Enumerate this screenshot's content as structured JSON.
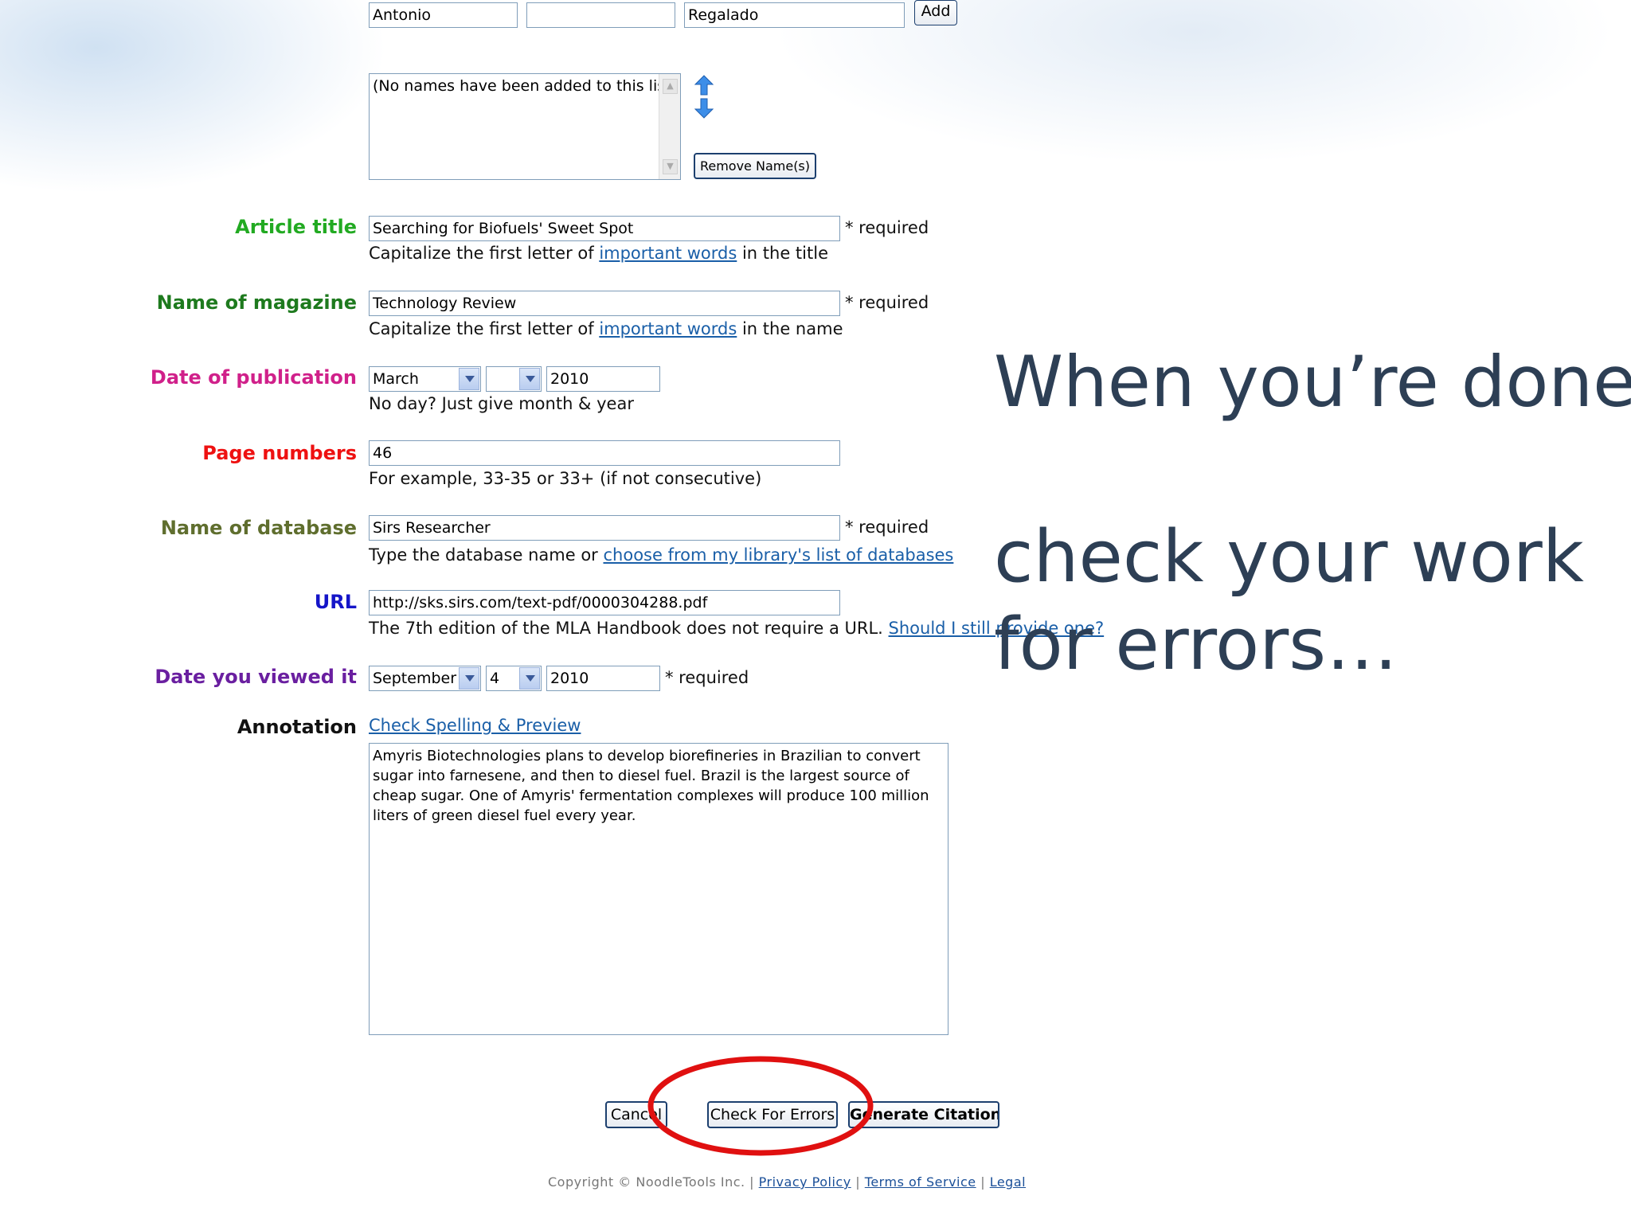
{
  "authors": {
    "first_name": "Antonio",
    "middle_name": "",
    "last_name": "Regalado",
    "add_button": "Add",
    "list_placeholder": "(No names have been added to this list)",
    "remove_button": "Remove Name(s)"
  },
  "article_title": {
    "label": "Article title",
    "value": "Searching for  Biofuels' Sweet Spot",
    "required": "* required",
    "hint_before": "Capitalize the first letter of ",
    "hint_link": "important words",
    "hint_after": " in the title"
  },
  "magazine": {
    "label": "Name of magazine",
    "value": "Technology Review",
    "required": "* required",
    "hint_before": "Capitalize the first letter of ",
    "hint_link": "important words",
    "hint_after": " in the name"
  },
  "pub_date": {
    "label": "Date of publication",
    "month": "March",
    "day": "",
    "year": "2010",
    "hint": "No day? Just give month & year"
  },
  "pages": {
    "label": "Page numbers",
    "value": "46",
    "hint": "For example, 33-35 or 33+ (if not consecutive)"
  },
  "database": {
    "label": "Name of database",
    "value": "Sirs Researcher",
    "required": "* required",
    "hint_before": "Type the database name or ",
    "hint_link": "choose from my library's list of databases"
  },
  "url": {
    "label": "URL",
    "value": "http://sks.sirs.com/text-pdf/0000304288.pdf",
    "hint_before": "The 7th edition of the MLA Handbook does not require a URL. ",
    "hint_link": "Should I still provide one?"
  },
  "viewed_date": {
    "label": "Date you viewed it",
    "month": "September",
    "day": "4",
    "year": "2010",
    "required": "* required"
  },
  "annotation": {
    "label": "Annotation",
    "link": "Check Spelling & Preview",
    "text": "Amyris Biotechnologies plans to develop biorefineries in Brazilian to convert sugar into farnesene, and then to diesel fuel. Brazil is the largest source of cheap sugar. One of Amyris' fermentation complexes will produce 100 million liters of green diesel fuel every year."
  },
  "buttons": {
    "cancel": "Cancel",
    "check_errors": "Check For Errors",
    "generate": "Generate Citation"
  },
  "footer": {
    "copyright": "Copyright © NoodleTools Inc. |",
    "privacy": "Privacy Policy",
    "sep1": "|",
    "terms": "Terms of Service",
    "sep2": "|",
    "legal": "Legal"
  },
  "slide_text": {
    "line1": "When you’re done,",
    "line2": "check your work",
    "line3": "for errors…"
  },
  "colors": {
    "article_title": "#22aa22",
    "magazine": "#1e7a1e",
    "pub_date": "#d0208a",
    "pages": "#ee1111",
    "database": "#5f6e2e",
    "url": "#1515c8",
    "viewed_date": "#6a1fa0",
    "annotation": "#111111",
    "highlight_circle": "#e01010"
  }
}
